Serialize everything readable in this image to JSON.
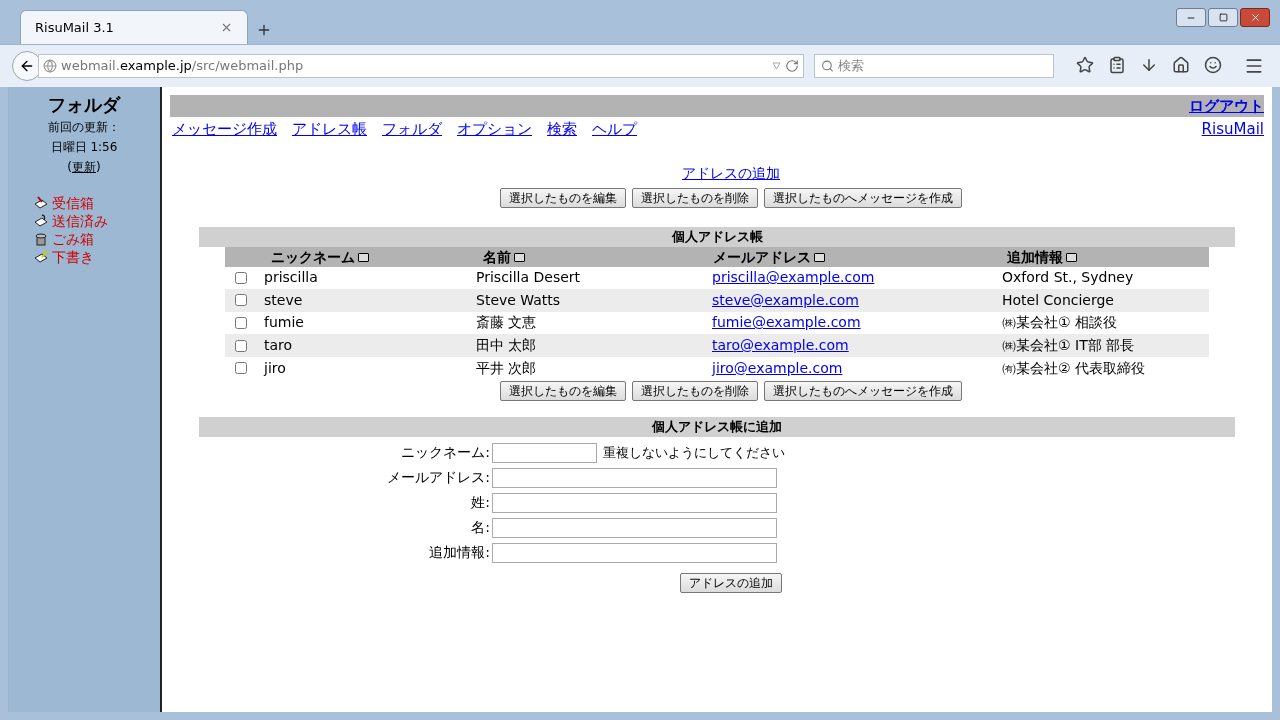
{
  "browser": {
    "tab_title": "RisuMail 3.1",
    "url": {
      "subdomain": "webmail.",
      "domain": "example.jp",
      "path": "/src/webmail.php"
    },
    "search_placeholder": "検索"
  },
  "sidebar": {
    "title": "フォルダ",
    "last_update_label": "前回の更新：",
    "last_update_time": "日曜日 1:56",
    "refresh_open": "(",
    "refresh_link": "更新",
    "refresh_close": ")",
    "folders": [
      {
        "name": "受信箱",
        "kind": "inbox"
      },
      {
        "name": "送信済み",
        "kind": "sent"
      },
      {
        "name": "ごみ箱",
        "kind": "trash"
      },
      {
        "name": "下書き",
        "kind": "drafts"
      }
    ]
  },
  "topbar": {
    "logout": "ログアウト",
    "menu": [
      "メッセージ作成",
      "アドレス帳",
      "フォルダ",
      "オプション",
      "検索",
      "ヘルプ"
    ],
    "brand": "RisuMail"
  },
  "add_address_link": "アドレスの追加",
  "actions": [
    "選択したものを編集",
    "選択したものを削除",
    "選択したものへメッセージを作成"
  ],
  "actions_bottom": [
    "選択したものを編集",
    "選択したものを削除",
    "選択したものへメッセージを作成"
  ],
  "addressbook": {
    "title": "個人アドレス帳",
    "columns": [
      "ニックネーム",
      "名前",
      "メールアドレス",
      "追加情報"
    ],
    "rows": [
      {
        "nickname": "priscilla",
        "name": "Priscilla Desert",
        "email": "priscilla@example.com",
        "info": "Oxford St., Sydney",
        "checked": false
      },
      {
        "nickname": "steve",
        "name": "Steve Watts",
        "email": "steve@example.com",
        "info": "Hotel Concierge",
        "checked": false
      },
      {
        "nickname": "fumie",
        "name": "斎藤 文恵",
        "email": "fumie@example.com",
        "info": "㈱某会社① 相談役",
        "checked": false
      },
      {
        "nickname": "taro",
        "name": "田中 太郎",
        "email": "taro@example.com",
        "info": "㈱某会社① IT部 部長",
        "checked": false
      },
      {
        "nickname": "jiro",
        "name": "平井 次郎",
        "email": "jiro@example.com",
        "info": "㈲某会社② 代表取締役",
        "checked": false
      }
    ]
  },
  "add_form": {
    "title": "個人アドレス帳に追加",
    "fields": [
      {
        "label": "ニックネーム:",
        "hint": "重複しないようにしてください"
      },
      {
        "label": "メールアドレス:"
      },
      {
        "label": "姓:"
      },
      {
        "label": "名:"
      },
      {
        "label": "追加情報:"
      }
    ],
    "submit": "アドレスの追加"
  }
}
